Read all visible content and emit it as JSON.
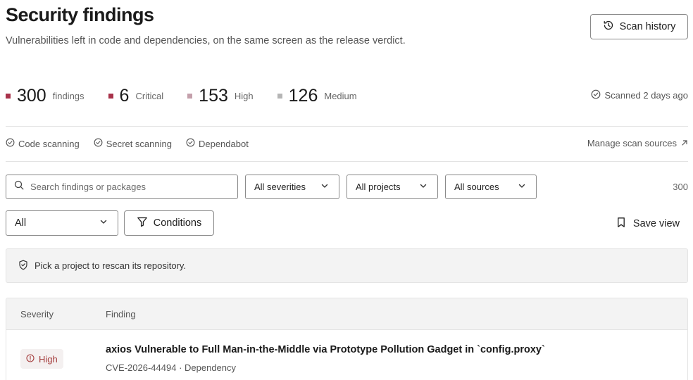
{
  "header": {
    "title": "Security findings",
    "subtitle": "Vulnerabilities left in code and dependencies, on the same screen as the release verdict.",
    "scan_history_label": "Scan history"
  },
  "stats": [
    {
      "value": "300",
      "label": "findings",
      "color": "#a8324a"
    },
    {
      "value": "6",
      "label": "Critical",
      "color": "#a8324a"
    },
    {
      "value": "153",
      "label": "High",
      "color": "#c4a0ab"
    },
    {
      "value": "126",
      "label": "Medium",
      "color": "#b5b5b5"
    }
  ],
  "scanned": "Scanned 2 days ago",
  "sources": {
    "items": [
      "Code scanning",
      "Secret scanning",
      "Dependabot"
    ],
    "manage_label": "Manage scan sources"
  },
  "filters": {
    "search_placeholder": "Search findings or packages",
    "severity": "All severities",
    "projects": "All projects",
    "sources": "All sources",
    "count": "300"
  },
  "view": {
    "selected": "All",
    "conditions_label": "Conditions",
    "save_label": "Save view"
  },
  "notice": "Pick a project to rescan its repository.",
  "table": {
    "columns": [
      "Severity",
      "Finding"
    ],
    "rows": [
      {
        "severity": "High",
        "title": "axios Vulnerable to Full Man-in-the-Middle via Prototype Pollution Gadget in `config.proxy`",
        "meta": "CVE-2026-44494 · Dependency"
      }
    ]
  },
  "colors": {
    "accent": "#a8324a",
    "high_badge_text": "#a33a3a",
    "high_badge_bg": "#f4f0f0"
  }
}
